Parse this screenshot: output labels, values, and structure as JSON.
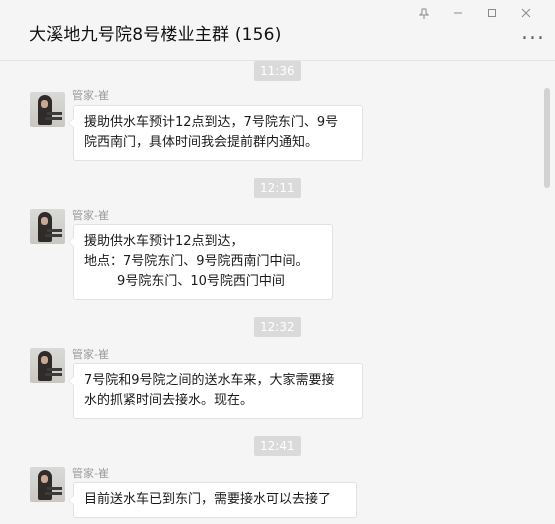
{
  "header": {
    "title": "大溪地九号院8号楼业主群 (156)",
    "more_label": "..."
  },
  "window_controls": {
    "pin_icon": "pin-icon",
    "minimize_icon": "minimize-icon",
    "maximize_icon": "maximize-icon",
    "close_icon": "close-icon"
  },
  "messages": [
    {
      "timestamp": "11:36",
      "sender": "管家-崔",
      "lines": [
        "援助供水车预计12点到达，7号院东门、9号",
        "院西南门，具体时间我会提前群内通知。"
      ]
    },
    {
      "timestamp": "12:11",
      "sender": "管家-崔",
      "lines": [
        "援助供水车预计12点到达，",
        "地点：7号院东门、9号院西南门中间。",
        "        9号院东门、10号院西门中间"
      ]
    },
    {
      "timestamp": "12:32",
      "sender": "管家-崔",
      "lines": [
        "7号院和9号院之间的送水车来，大家需要接",
        "水的抓紧时间去接水。现在。"
      ]
    },
    {
      "timestamp": "12:41",
      "sender": "管家-崔",
      "lines": [
        "目前送水车已到东门，需要接水可以去接了"
      ]
    }
  ],
  "colors": {
    "background": "#f5f5f5",
    "bubble": "#ffffff",
    "timestamp_bg": "#dadada"
  }
}
